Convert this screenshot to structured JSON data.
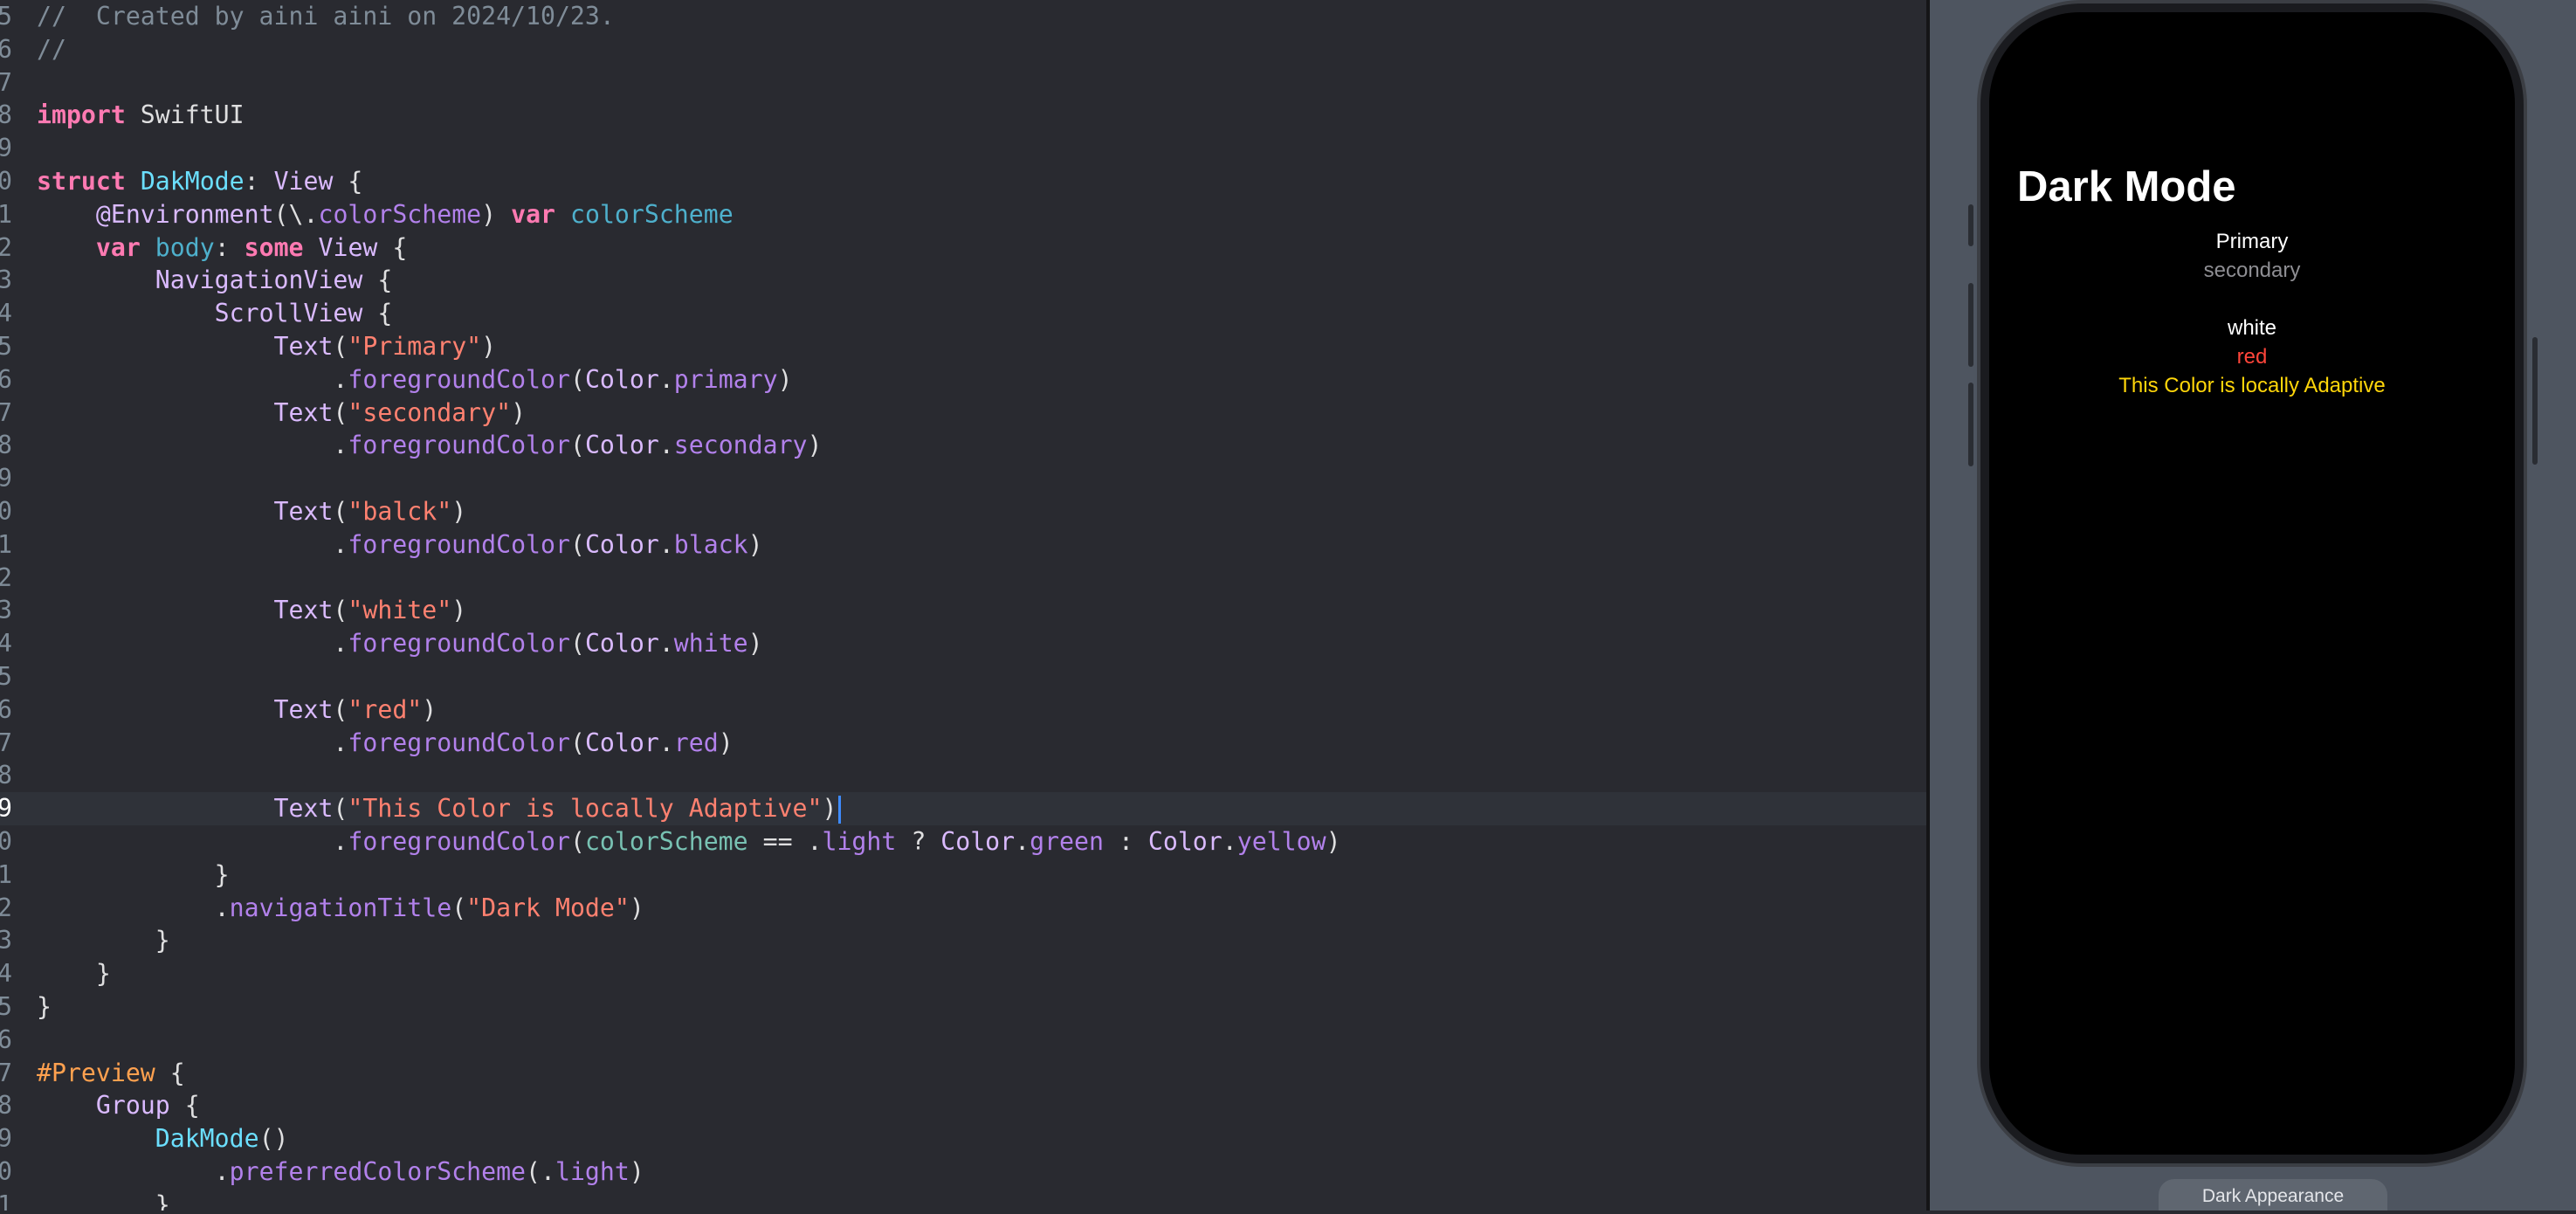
{
  "editor": {
    "lines": [
      {
        "num": "5",
        "tokens": [
          {
            "c": "t-comment",
            "t": "//  Created by aini aini on 2024/10/23."
          }
        ]
      },
      {
        "num": "6",
        "tokens": [
          {
            "c": "t-comment",
            "t": "//"
          }
        ]
      },
      {
        "num": "7",
        "tokens": []
      },
      {
        "num": "8",
        "tokens": [
          {
            "c": "t-kw",
            "t": "import"
          },
          {
            "c": "t-plain",
            "t": " SwiftUI"
          }
        ]
      },
      {
        "num": "9",
        "tokens": []
      },
      {
        "num": "0",
        "tokens": [
          {
            "c": "t-kw",
            "t": "struct"
          },
          {
            "c": "t-plain",
            "t": " "
          },
          {
            "c": "t-decl",
            "t": "DakMode"
          },
          {
            "c": "t-plain",
            "t": ": "
          },
          {
            "c": "t-ty",
            "t": "View"
          },
          {
            "c": "t-plain",
            "t": " {"
          }
        ]
      },
      {
        "num": "1",
        "tokens": [
          {
            "c": "t-plain",
            "t": "    "
          },
          {
            "c": "t-attr",
            "t": "@Environment"
          },
          {
            "c": "t-plain",
            "t": "(\\."
          },
          {
            "c": "t-mem",
            "t": "colorScheme"
          },
          {
            "c": "t-plain",
            "t": ") "
          },
          {
            "c": "t-kw",
            "t": "var"
          },
          {
            "c": "t-plain",
            "t": " "
          },
          {
            "c": "t-var",
            "t": "colorScheme"
          }
        ]
      },
      {
        "num": "2",
        "tokens": [
          {
            "c": "t-plain",
            "t": "    "
          },
          {
            "c": "t-kw",
            "t": "var"
          },
          {
            "c": "t-plain",
            "t": " "
          },
          {
            "c": "t-var",
            "t": "body"
          },
          {
            "c": "t-plain",
            "t": ": "
          },
          {
            "c": "t-kw",
            "t": "some"
          },
          {
            "c": "t-plain",
            "t": " "
          },
          {
            "c": "t-ty",
            "t": "View"
          },
          {
            "c": "t-plain",
            "t": " {"
          }
        ]
      },
      {
        "num": "3",
        "tokens": [
          {
            "c": "t-plain",
            "t": "        "
          },
          {
            "c": "t-ty",
            "t": "NavigationView"
          },
          {
            "c": "t-plain",
            "t": " {"
          }
        ]
      },
      {
        "num": "4",
        "tokens": [
          {
            "c": "t-plain",
            "t": "            "
          },
          {
            "c": "t-ty",
            "t": "ScrollView"
          },
          {
            "c": "t-plain",
            "t": " {"
          }
        ]
      },
      {
        "num": "5",
        "tokens": [
          {
            "c": "t-plain",
            "t": "                "
          },
          {
            "c": "t-ty",
            "t": "Text"
          },
          {
            "c": "t-plain",
            "t": "("
          },
          {
            "c": "t-str",
            "t": "\"Primary\""
          },
          {
            "c": "t-plain",
            "t": ")"
          }
        ]
      },
      {
        "num": "6",
        "tokens": [
          {
            "c": "t-plain",
            "t": "                    ."
          },
          {
            "c": "t-mem",
            "t": "foregroundColor"
          },
          {
            "c": "t-plain",
            "t": "("
          },
          {
            "c": "t-ty",
            "t": "Color"
          },
          {
            "c": "t-plain",
            "t": "."
          },
          {
            "c": "t-mem",
            "t": "primary"
          },
          {
            "c": "t-plain",
            "t": ")"
          }
        ]
      },
      {
        "num": "7",
        "tokens": [
          {
            "c": "t-plain",
            "t": "                "
          },
          {
            "c": "t-ty",
            "t": "Text"
          },
          {
            "c": "t-plain",
            "t": "("
          },
          {
            "c": "t-str",
            "t": "\"secondary\""
          },
          {
            "c": "t-plain",
            "t": ")"
          }
        ]
      },
      {
        "num": "8",
        "tokens": [
          {
            "c": "t-plain",
            "t": "                    ."
          },
          {
            "c": "t-mem",
            "t": "foregroundColor"
          },
          {
            "c": "t-plain",
            "t": "("
          },
          {
            "c": "t-ty",
            "t": "Color"
          },
          {
            "c": "t-plain",
            "t": "."
          },
          {
            "c": "t-mem",
            "t": "secondary"
          },
          {
            "c": "t-plain",
            "t": ")"
          }
        ]
      },
      {
        "num": "9",
        "tokens": []
      },
      {
        "num": "0",
        "tokens": [
          {
            "c": "t-plain",
            "t": "                "
          },
          {
            "c": "t-ty",
            "t": "Text"
          },
          {
            "c": "t-plain",
            "t": "("
          },
          {
            "c": "t-str",
            "t": "\"balck\""
          },
          {
            "c": "t-plain",
            "t": ")"
          }
        ]
      },
      {
        "num": "1",
        "tokens": [
          {
            "c": "t-plain",
            "t": "                    ."
          },
          {
            "c": "t-mem",
            "t": "foregroundColor"
          },
          {
            "c": "t-plain",
            "t": "("
          },
          {
            "c": "t-ty",
            "t": "Color"
          },
          {
            "c": "t-plain",
            "t": "."
          },
          {
            "c": "t-mem",
            "t": "black"
          },
          {
            "c": "t-plain",
            "t": ")"
          }
        ]
      },
      {
        "num": "2",
        "tokens": []
      },
      {
        "num": "3",
        "tokens": [
          {
            "c": "t-plain",
            "t": "                "
          },
          {
            "c": "t-ty",
            "t": "Text"
          },
          {
            "c": "t-plain",
            "t": "("
          },
          {
            "c": "t-str",
            "t": "\"white\""
          },
          {
            "c": "t-plain",
            "t": ")"
          }
        ]
      },
      {
        "num": "4",
        "tokens": [
          {
            "c": "t-plain",
            "t": "                    ."
          },
          {
            "c": "t-mem",
            "t": "foregroundColor"
          },
          {
            "c": "t-plain",
            "t": "("
          },
          {
            "c": "t-ty",
            "t": "Color"
          },
          {
            "c": "t-plain",
            "t": "."
          },
          {
            "c": "t-mem",
            "t": "white"
          },
          {
            "c": "t-plain",
            "t": ")"
          }
        ]
      },
      {
        "num": "5",
        "tokens": []
      },
      {
        "num": "6",
        "tokens": [
          {
            "c": "t-plain",
            "t": "                "
          },
          {
            "c": "t-ty",
            "t": "Text"
          },
          {
            "c": "t-plain",
            "t": "("
          },
          {
            "c": "t-str",
            "t": "\"red\""
          },
          {
            "c": "t-plain",
            "t": ")"
          }
        ]
      },
      {
        "num": "7",
        "tokens": [
          {
            "c": "t-plain",
            "t": "                    ."
          },
          {
            "c": "t-mem",
            "t": "foregroundColor"
          },
          {
            "c": "t-plain",
            "t": "("
          },
          {
            "c": "t-ty",
            "t": "Color"
          },
          {
            "c": "t-plain",
            "t": "."
          },
          {
            "c": "t-mem",
            "t": "red"
          },
          {
            "c": "t-plain",
            "t": ")"
          }
        ]
      },
      {
        "num": "8",
        "tokens": []
      },
      {
        "num": "9",
        "current": true,
        "cursor": true,
        "tokens": [
          {
            "c": "t-plain",
            "t": "                "
          },
          {
            "c": "t-ty",
            "t": "Text"
          },
          {
            "c": "t-plain",
            "t": "("
          },
          {
            "c": "t-str",
            "t": "\"This Color is locally Adaptive\""
          },
          {
            "c": "t-plain",
            "t": ")"
          }
        ]
      },
      {
        "num": "0",
        "tokens": [
          {
            "c": "t-plain",
            "t": "                    ."
          },
          {
            "c": "t-mem",
            "t": "foregroundColor"
          },
          {
            "c": "t-plain",
            "t": "("
          },
          {
            "c": "t-id",
            "t": "colorScheme"
          },
          {
            "c": "t-plain",
            "t": " == ."
          },
          {
            "c": "t-mem",
            "t": "light"
          },
          {
            "c": "t-plain",
            "t": " ? "
          },
          {
            "c": "t-ty",
            "t": "Color"
          },
          {
            "c": "t-plain",
            "t": "."
          },
          {
            "c": "t-mem",
            "t": "green"
          },
          {
            "c": "t-plain",
            "t": " : "
          },
          {
            "c": "t-ty",
            "t": "Color"
          },
          {
            "c": "t-plain",
            "t": "."
          },
          {
            "c": "t-mem",
            "t": "yellow"
          },
          {
            "c": "t-plain",
            "t": ")"
          }
        ]
      },
      {
        "num": "1",
        "tokens": [
          {
            "c": "t-plain",
            "t": "            }"
          }
        ]
      },
      {
        "num": "2",
        "tokens": [
          {
            "c": "t-plain",
            "t": "            ."
          },
          {
            "c": "t-mem",
            "t": "navigationTitle"
          },
          {
            "c": "t-plain",
            "t": "("
          },
          {
            "c": "t-str",
            "t": "\"Dark Mode\""
          },
          {
            "c": "t-plain",
            "t": ")"
          }
        ]
      },
      {
        "num": "3",
        "tokens": [
          {
            "c": "t-plain",
            "t": "        }"
          }
        ]
      },
      {
        "num": "4",
        "tokens": [
          {
            "c": "t-plain",
            "t": "    }"
          }
        ]
      },
      {
        "num": "5",
        "tokens": [
          {
            "c": "t-plain",
            "t": "}"
          }
        ]
      },
      {
        "num": "6",
        "tokens": []
      },
      {
        "num": "7",
        "tokens": [
          {
            "c": "t-macro",
            "t": "#Preview"
          },
          {
            "c": "t-plain",
            "t": " {"
          }
        ]
      },
      {
        "num": "8",
        "tokens": [
          {
            "c": "t-plain",
            "t": "    "
          },
          {
            "c": "t-ty",
            "t": "Group"
          },
          {
            "c": "t-plain",
            "t": " {"
          }
        ]
      },
      {
        "num": "9",
        "tokens": [
          {
            "c": "t-plain",
            "t": "        "
          },
          {
            "c": "t-decl",
            "t": "DakMode"
          },
          {
            "c": "t-plain",
            "t": "()"
          }
        ]
      },
      {
        "num": "0",
        "tokens": [
          {
            "c": "t-plain",
            "t": "            ."
          },
          {
            "c": "t-mem",
            "t": "preferredColorScheme"
          },
          {
            "c": "t-plain",
            "t": "(."
          },
          {
            "c": "t-mem",
            "t": "light"
          },
          {
            "c": "t-plain",
            "t": ")"
          }
        ]
      },
      {
        "num": "1",
        "tokens": [
          {
            "c": "t-plain",
            "t": "        }"
          }
        ]
      }
    ]
  },
  "preview": {
    "nav_title": "Dark Mode",
    "texts": {
      "primary": "Primary",
      "secondary": "secondary",
      "white": "white",
      "red": "red",
      "adaptive": "This Color is locally Adaptive"
    },
    "colors": {
      "primary": "#ffffff",
      "secondary": "#8e8e93",
      "white": "#ffffff",
      "red": "#ff453a",
      "adaptive": "#ffd60a"
    },
    "appearance_button": "Dark Appearance"
  }
}
